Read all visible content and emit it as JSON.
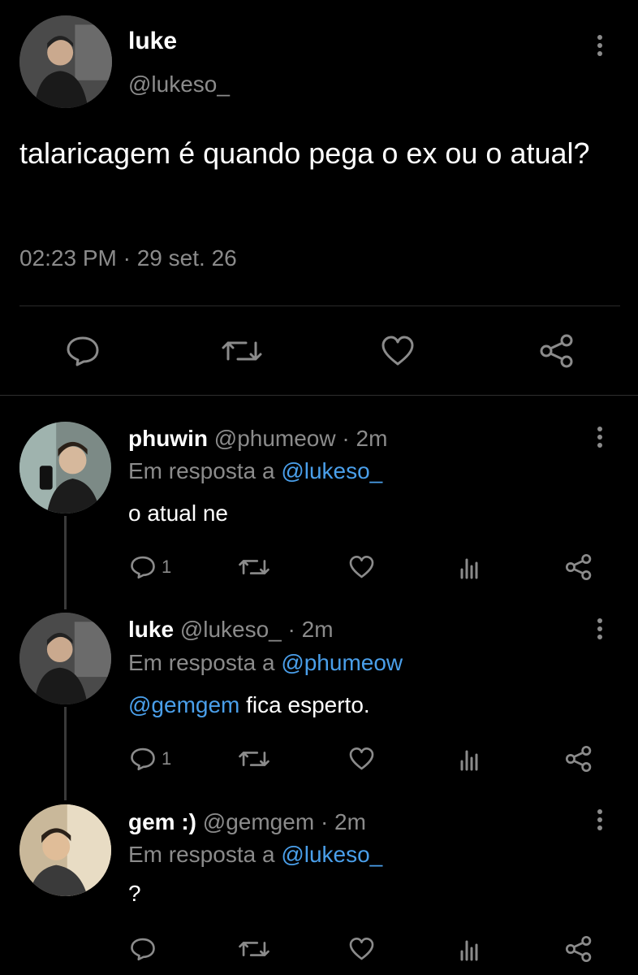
{
  "main_tweet": {
    "display_name": "luke",
    "handle": "@lukeso_",
    "text": "talaricagem é quando pega o ex ou o atual?",
    "timestamp": "02:23 PM · 29 set. 26",
    "avatar_icon": "profile-photo"
  },
  "replies": [
    {
      "display_name": "phuwin",
      "handle": "@phumeow",
      "time": "· 2m",
      "reply_prefix": "Em resposta a",
      "reply_to": "@lukeso_",
      "text": "o atual ne",
      "mention": "",
      "reply_count": "1"
    },
    {
      "display_name": "luke",
      "handle": "@lukeso_",
      "time": "· 2m",
      "reply_prefix": "Em resposta a",
      "reply_to": "@phumeow",
      "text": "fica esperto.",
      "mention": "@gemgem",
      "reply_count": "1"
    },
    {
      "display_name": "gem :)",
      "handle": "@gemgem",
      "time": "· 2m",
      "reply_prefix": "Em resposta a",
      "reply_to": "@lukeso_",
      "text": "?",
      "mention": "",
      "reply_count": ""
    }
  ],
  "colors": {
    "background": "#000000",
    "text": "#ffffff",
    "secondary": "#8b8b8b",
    "link": "#4a9fea"
  },
  "icons": [
    "reply-icon",
    "retweet-icon",
    "like-icon",
    "analytics-icon",
    "share-icon",
    "more-options-icon"
  ]
}
